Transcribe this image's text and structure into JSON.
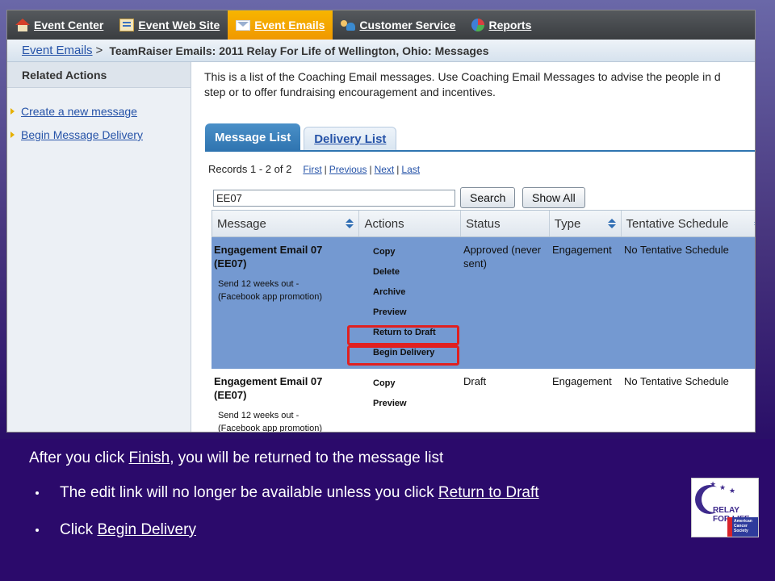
{
  "topnav": {
    "items": [
      {
        "label": "Event Center",
        "icon": "house-icon"
      },
      {
        "label": "Event Web Site",
        "icon": "web-page-icon"
      },
      {
        "label": "Event Emails",
        "icon": "envelope-icon",
        "active": true
      },
      {
        "label": "Customer Service",
        "icon": "people-icon"
      },
      {
        "label": "Reports",
        "icon": "pie-chart-icon"
      }
    ]
  },
  "breadcrumb": {
    "link": "Event Emails",
    "separator": ">",
    "title": "TeamRaiser Emails: 2011 Relay For Life of Wellington, Ohio: Messages"
  },
  "sidebar": {
    "heading": "Related Actions",
    "links": [
      "Create a new message",
      "Begin Message Delivery"
    ]
  },
  "main": {
    "intro_line1": "This is a list of the Coaching Email messages. Use Coaching Email Messages to advise the people in d",
    "intro_line2": "step or to offer fundraising encouragement and incentives.",
    "tabs": [
      "Message List",
      "Delivery List"
    ],
    "records": "Records 1 - 2 of 2",
    "pager": {
      "first": "First",
      "previous": "Previous",
      "next": "Next",
      "last": "Last",
      "sep": "|"
    },
    "search": {
      "value": "EE07",
      "button": "Search",
      "show_all": "Show All",
      "edge": "F"
    },
    "columns": [
      "Message",
      "Actions",
      "Status",
      "Type",
      "Tentative Schedule"
    ],
    "rows": [
      {
        "title_line1": "Engagement Email 07",
        "title_line2": "(EE07)",
        "sub_line1": "Send 12 weeks out -",
        "sub_line2": "(Facebook app promotion)",
        "actions": [
          "Copy",
          "Delete",
          "Archive",
          "Preview",
          "Return to Draft",
          "Begin Delivery"
        ],
        "status_line1": "Approved (never",
        "status_line2": "sent)",
        "type": "Engagement",
        "schedule": "No Tentative Schedule"
      },
      {
        "title_line1": "Engagement Email 07",
        "title_line2": "(EE07)",
        "sub_line1": "Send 12 weeks out -",
        "sub_line2": "(Facebook app promotion)",
        "actions": [
          "Copy",
          "Preview"
        ],
        "status_line1": "Draft",
        "status_line2": "",
        "type": "Engagement",
        "schedule": "No Tentative Schedule"
      }
    ]
  },
  "slide": {
    "caption_pre": "After you click ",
    "caption_link": "Finish",
    "caption_post": ", you will be returned to the message list",
    "bullet1_pre": "The edit link will no longer be available unless you click ",
    "bullet1_link": "Return to Draft",
    "bullet2_pre": "Click ",
    "bullet2_link": "Begin Delivery"
  },
  "logo": {
    "line1": "RELAY",
    "line2": "FOR LIFE",
    "acs_line1": "American",
    "acs_line2": "Cancer",
    "acs_line3": "Society"
  },
  "colors": {
    "accent_active_tab": "#f09800",
    "row_highlight": "#7499d1",
    "annotation_box": "#e02020",
    "slide_background": "#2b0a6b"
  }
}
